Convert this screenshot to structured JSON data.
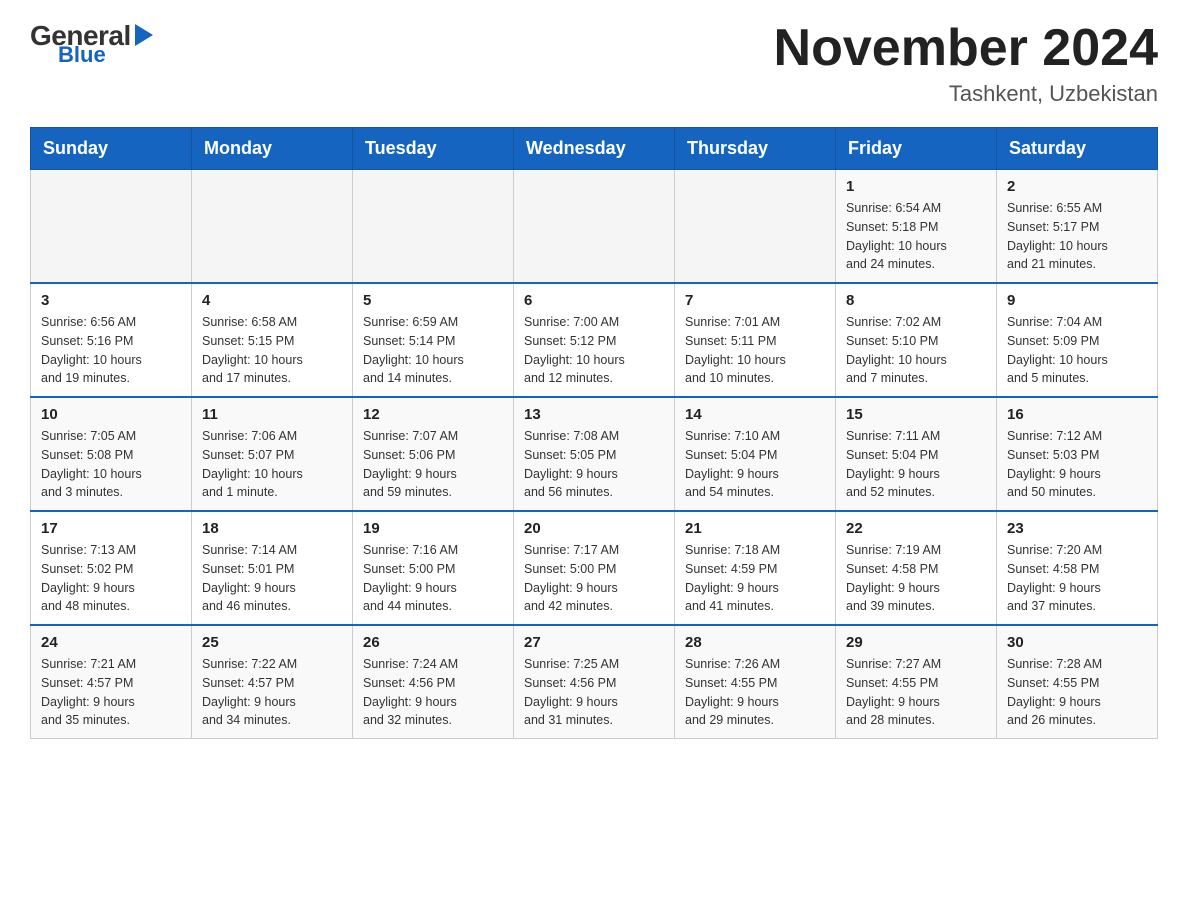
{
  "header": {
    "logo_general": "General",
    "logo_blue": "Blue",
    "month_title": "November 2024",
    "location": "Tashkent, Uzbekistan"
  },
  "days_of_week": [
    "Sunday",
    "Monday",
    "Tuesday",
    "Wednesday",
    "Thursday",
    "Friday",
    "Saturday"
  ],
  "weeks": [
    {
      "days": [
        {
          "num": "",
          "info": ""
        },
        {
          "num": "",
          "info": ""
        },
        {
          "num": "",
          "info": ""
        },
        {
          "num": "",
          "info": ""
        },
        {
          "num": "",
          "info": ""
        },
        {
          "num": "1",
          "info": "Sunrise: 6:54 AM\nSunset: 5:18 PM\nDaylight: 10 hours\nand 24 minutes."
        },
        {
          "num": "2",
          "info": "Sunrise: 6:55 AM\nSunset: 5:17 PM\nDaylight: 10 hours\nand 21 minutes."
        }
      ]
    },
    {
      "days": [
        {
          "num": "3",
          "info": "Sunrise: 6:56 AM\nSunset: 5:16 PM\nDaylight: 10 hours\nand 19 minutes."
        },
        {
          "num": "4",
          "info": "Sunrise: 6:58 AM\nSunset: 5:15 PM\nDaylight: 10 hours\nand 17 minutes."
        },
        {
          "num": "5",
          "info": "Sunrise: 6:59 AM\nSunset: 5:14 PM\nDaylight: 10 hours\nand 14 minutes."
        },
        {
          "num": "6",
          "info": "Sunrise: 7:00 AM\nSunset: 5:12 PM\nDaylight: 10 hours\nand 12 minutes."
        },
        {
          "num": "7",
          "info": "Sunrise: 7:01 AM\nSunset: 5:11 PM\nDaylight: 10 hours\nand 10 minutes."
        },
        {
          "num": "8",
          "info": "Sunrise: 7:02 AM\nSunset: 5:10 PM\nDaylight: 10 hours\nand 7 minutes."
        },
        {
          "num": "9",
          "info": "Sunrise: 7:04 AM\nSunset: 5:09 PM\nDaylight: 10 hours\nand 5 minutes."
        }
      ]
    },
    {
      "days": [
        {
          "num": "10",
          "info": "Sunrise: 7:05 AM\nSunset: 5:08 PM\nDaylight: 10 hours\nand 3 minutes."
        },
        {
          "num": "11",
          "info": "Sunrise: 7:06 AM\nSunset: 5:07 PM\nDaylight: 10 hours\nand 1 minute."
        },
        {
          "num": "12",
          "info": "Sunrise: 7:07 AM\nSunset: 5:06 PM\nDaylight: 9 hours\nand 59 minutes."
        },
        {
          "num": "13",
          "info": "Sunrise: 7:08 AM\nSunset: 5:05 PM\nDaylight: 9 hours\nand 56 minutes."
        },
        {
          "num": "14",
          "info": "Sunrise: 7:10 AM\nSunset: 5:04 PM\nDaylight: 9 hours\nand 54 minutes."
        },
        {
          "num": "15",
          "info": "Sunrise: 7:11 AM\nSunset: 5:04 PM\nDaylight: 9 hours\nand 52 minutes."
        },
        {
          "num": "16",
          "info": "Sunrise: 7:12 AM\nSunset: 5:03 PM\nDaylight: 9 hours\nand 50 minutes."
        }
      ]
    },
    {
      "days": [
        {
          "num": "17",
          "info": "Sunrise: 7:13 AM\nSunset: 5:02 PM\nDaylight: 9 hours\nand 48 minutes."
        },
        {
          "num": "18",
          "info": "Sunrise: 7:14 AM\nSunset: 5:01 PM\nDaylight: 9 hours\nand 46 minutes."
        },
        {
          "num": "19",
          "info": "Sunrise: 7:16 AM\nSunset: 5:00 PM\nDaylight: 9 hours\nand 44 minutes."
        },
        {
          "num": "20",
          "info": "Sunrise: 7:17 AM\nSunset: 5:00 PM\nDaylight: 9 hours\nand 42 minutes."
        },
        {
          "num": "21",
          "info": "Sunrise: 7:18 AM\nSunset: 4:59 PM\nDaylight: 9 hours\nand 41 minutes."
        },
        {
          "num": "22",
          "info": "Sunrise: 7:19 AM\nSunset: 4:58 PM\nDaylight: 9 hours\nand 39 minutes."
        },
        {
          "num": "23",
          "info": "Sunrise: 7:20 AM\nSunset: 4:58 PM\nDaylight: 9 hours\nand 37 minutes."
        }
      ]
    },
    {
      "days": [
        {
          "num": "24",
          "info": "Sunrise: 7:21 AM\nSunset: 4:57 PM\nDaylight: 9 hours\nand 35 minutes."
        },
        {
          "num": "25",
          "info": "Sunrise: 7:22 AM\nSunset: 4:57 PM\nDaylight: 9 hours\nand 34 minutes."
        },
        {
          "num": "26",
          "info": "Sunrise: 7:24 AM\nSunset: 4:56 PM\nDaylight: 9 hours\nand 32 minutes."
        },
        {
          "num": "27",
          "info": "Sunrise: 7:25 AM\nSunset: 4:56 PM\nDaylight: 9 hours\nand 31 minutes."
        },
        {
          "num": "28",
          "info": "Sunrise: 7:26 AM\nSunset: 4:55 PM\nDaylight: 9 hours\nand 29 minutes."
        },
        {
          "num": "29",
          "info": "Sunrise: 7:27 AM\nSunset: 4:55 PM\nDaylight: 9 hours\nand 28 minutes."
        },
        {
          "num": "30",
          "info": "Sunrise: 7:28 AM\nSunset: 4:55 PM\nDaylight: 9 hours\nand 26 minutes."
        }
      ]
    }
  ]
}
